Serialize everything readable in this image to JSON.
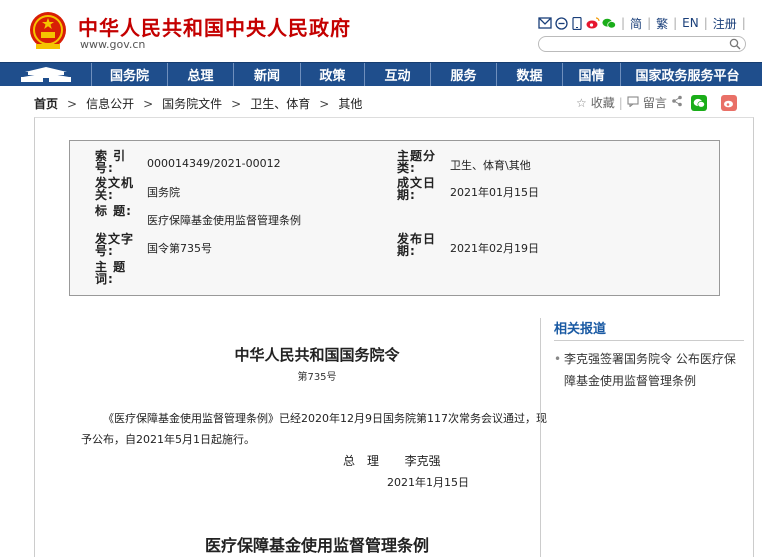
{
  "header": {
    "site_title": "中华人民共和国中央人民政府",
    "site_url": "www.gov.cn",
    "util": {
      "simplified": "简",
      "traditional": "繁",
      "english": "EN",
      "register": "注册"
    }
  },
  "nav": {
    "items": [
      "国务院",
      "总理",
      "新闻",
      "政策",
      "互动",
      "服务",
      "数据",
      "国情",
      "国家政务服务平台"
    ]
  },
  "breadcrumb": {
    "items": [
      "首页",
      "信息公开",
      "国务院文件",
      "卫生、体育",
      "其他"
    ]
  },
  "tools": {
    "favorite": "收藏",
    "comment": "留言"
  },
  "info": {
    "index_label": "索 引 号:",
    "index_value": "000014349/2021-00012",
    "subject_label": "主题分类:",
    "subject_value": "卫生、体育\\其他",
    "issuer_label": "发文机关:",
    "issuer_value": "国务院",
    "date_written_label": "成文日期:",
    "date_written_value": "2021年01月15日",
    "title_label": "标 题:",
    "title_value": "医疗保障基金使用监督管理条例",
    "doc_no_label": "发文字号:",
    "doc_no_value": "国令第735号",
    "publish_label": "发布日期:",
    "publish_value": "2021年02月19日",
    "keyword_label": "主 题 词:",
    "keyword_value": ""
  },
  "article": {
    "order_title": "中华人民共和国国务院令",
    "order_no": "第735号",
    "body": "《医疗保障基金使用监督管理条例》已经2020年12月9日国务院第117次常务会议通过，现予公布，自2021年5月1日起施行。",
    "signer_title": "总　理",
    "signer_name": "李克强",
    "sign_date": "2021年1月15日",
    "regulation_title": "医疗保障基金使用监督管理条例"
  },
  "related": {
    "title": "相关报道",
    "items": [
      "李克强签署国务院令 公布医疗保障基金使用监督管理条例"
    ]
  },
  "colors": {
    "nav_bg": "#1f4e8c",
    "title_red": "#c40000",
    "link_blue": "#1a5aa3"
  }
}
